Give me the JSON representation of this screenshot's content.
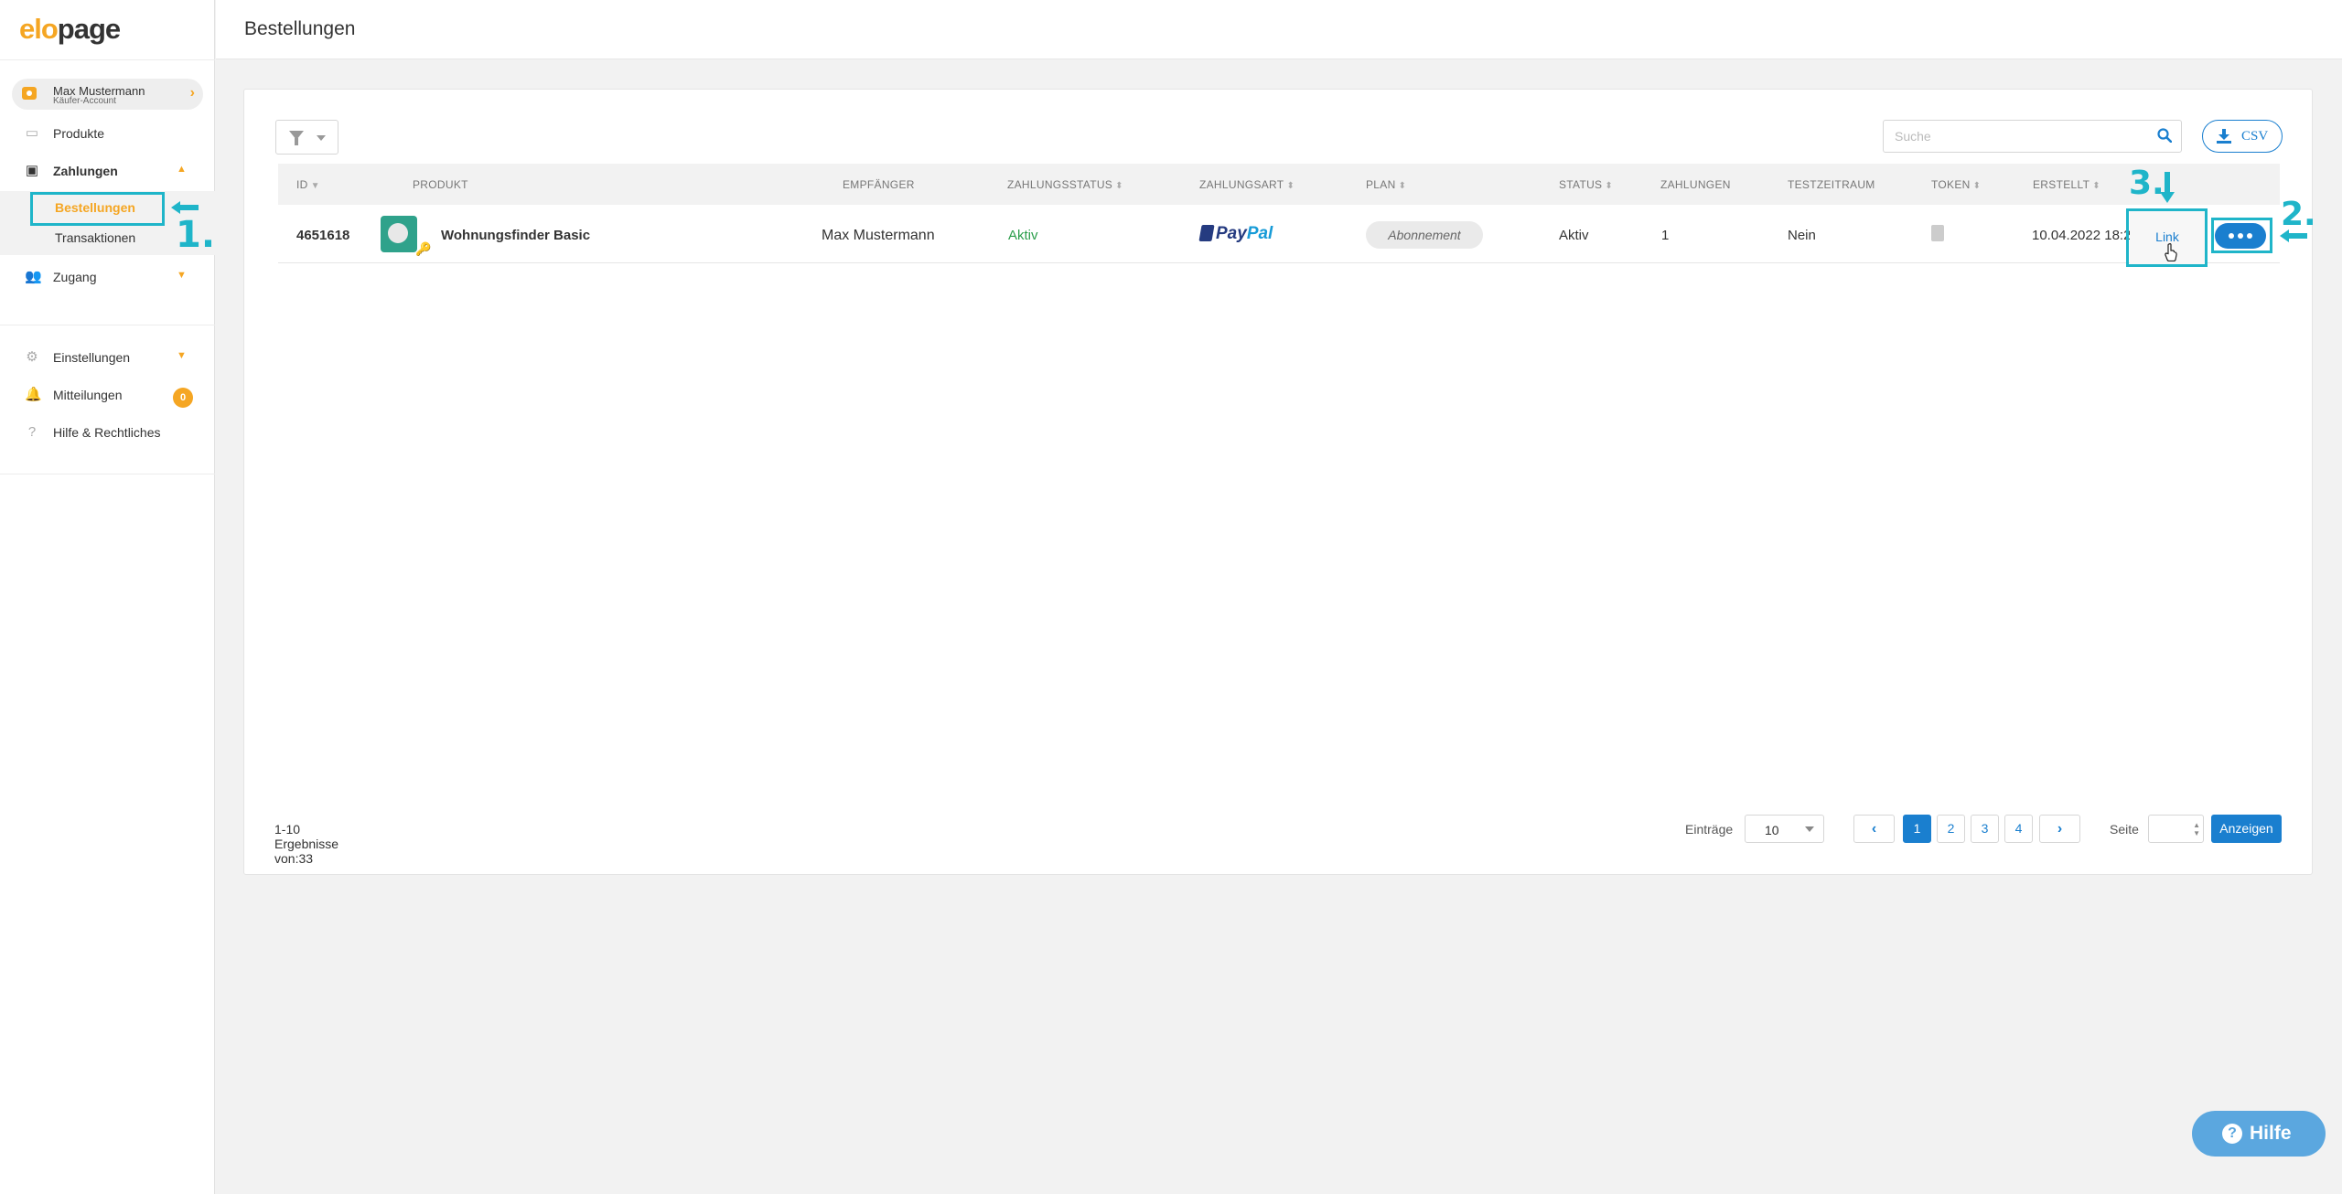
{
  "logo": {
    "part1": "elo",
    "part2": "page"
  },
  "account": {
    "name": "Max Mustermann",
    "role": "Käufer-Account"
  },
  "sidebar": {
    "produkte": "Produkte",
    "zahlungen": "Zahlungen",
    "bestellungen": "Bestellungen",
    "transaktionen": "Transaktionen",
    "zugang": "Zugang",
    "einstellungen": "Einstellungen",
    "mitteilungen": "Mitteilungen",
    "mitteilungen_count": "0",
    "hilfe": "Hilfe & Rechtliches"
  },
  "header": {
    "title": "Bestellungen"
  },
  "toolbar": {
    "search_placeholder": "Suche",
    "csv_label": "CSV"
  },
  "table": {
    "columns": [
      "ID",
      "PRODUKT",
      "EMPFÄNGER",
      "ZAHLUNGSSTATUS",
      "ZAHLUNGSART",
      "PLAN",
      "STATUS",
      "ZAHLUNGEN",
      "TESTZEITRAUM",
      "TOKEN",
      "ERSTELLT"
    ],
    "rows": [
      {
        "id": "4651618",
        "product": "Wohnungsfinder Basic",
        "recipient": "Max Mustermann",
        "payment_status": "Aktiv",
        "payment_method_1": "Pay",
        "payment_method_2": "Pal",
        "plan": "Abonnement",
        "status": "Aktiv",
        "payments": "1",
        "trial": "Nein",
        "created": "10.04.2022 18:2",
        "link_label": "Link"
      }
    ]
  },
  "annotations": {
    "one": "1.",
    "two": "2.",
    "three": "3."
  },
  "footer": {
    "results": "1-10 Ergebnisse von:33",
    "entries_label": "Einträge",
    "entries_value": "10",
    "pages": [
      "1",
      "2",
      "3",
      "4"
    ],
    "page_label": "Seite",
    "show_label": "Anzeigen"
  },
  "help_label": "Hilfe",
  "colors": {
    "accent": "#1a7fcf",
    "brand": "#f5a623",
    "annotation": "#1fb5c9",
    "success": "#2a9d4a"
  }
}
